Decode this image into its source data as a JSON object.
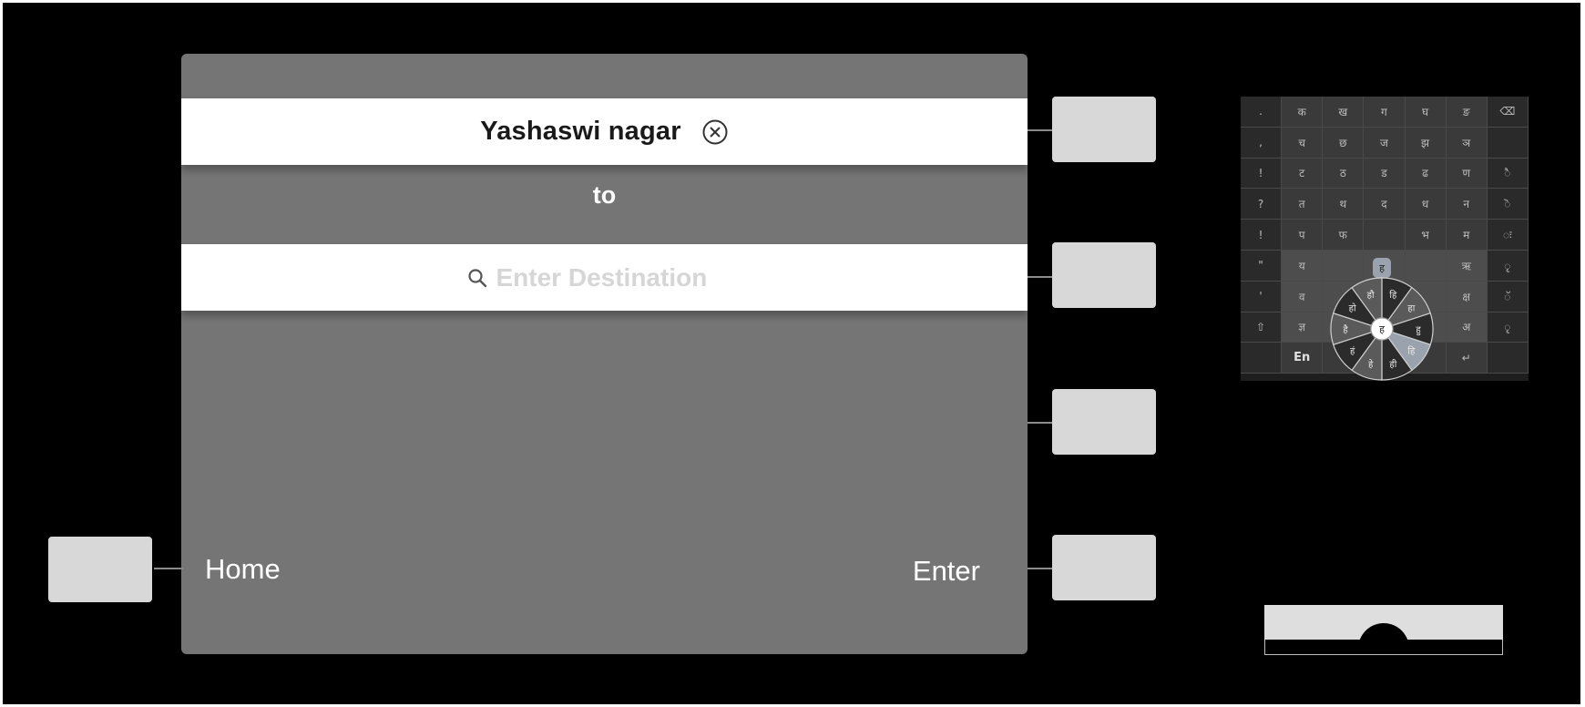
{
  "screen": {
    "origin_value": "Yashaswi nagar",
    "clear_icon": "circle-x-icon",
    "to_label": "to",
    "destination_placeholder": "Enter Destination",
    "destination_value": "",
    "search_icon": "search-icon",
    "home_label": "Home",
    "enter_label": "Enter"
  },
  "keyboard": {
    "language_label": "En",
    "rows": [
      [
        ".",
        "क",
        "ख",
        "ग",
        "घ",
        "ङ",
        "⌫"
      ],
      [
        ",",
        "च",
        "छ",
        "ज",
        "झ",
        "ञ",
        ""
      ],
      [
        "!",
        "ट",
        "ठ",
        "ड",
        "ढ",
        "ण",
        "ै"
      ],
      [
        "?",
        "त",
        "थ",
        "द",
        "ध",
        "न",
        "ॆ"
      ],
      [
        "!",
        "प",
        "फ",
        "",
        "भ",
        "म",
        "ः"
      ],
      [
        "\"",
        "य",
        "",
        "",
        "",
        "ऋ",
        "ृ"
      ],
      [
        "'",
        "व",
        "",
        "",
        "",
        "क्ष",
        "ॅ"
      ],
      [
        "⇧",
        "ज्ञ",
        "",
        "",
        "",
        "अ",
        "ृ"
      ],
      [
        "",
        "En",
        "",
        "",
        "",
        "↵",
        ""
      ]
    ],
    "wheel_center": "ह",
    "wheel_top": "ह",
    "wheel_segments": [
      "हि",
      "हा",
      "हु",
      "हि",
      "ही",
      "हे",
      "हं",
      "है",
      "हो",
      "हौ"
    ]
  },
  "colors": {
    "background": "#000000",
    "screen": "#757575",
    "bar": "#ffffff",
    "hardware_button": "#d8d8d8"
  }
}
